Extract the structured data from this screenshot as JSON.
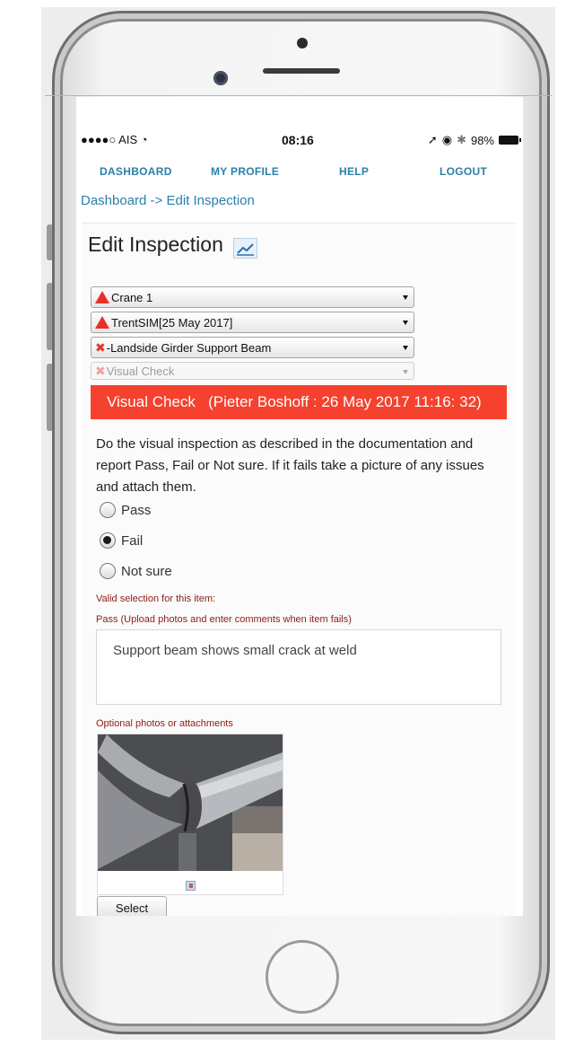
{
  "status_bar": {
    "carrier": "●●●●○ AIS",
    "wifi_icon": "wifi-icon",
    "time": "08:16",
    "battery": "98%"
  },
  "nav": {
    "dashboard": "DASHBOARD",
    "profile": "MY PROFILE",
    "help": "HELP",
    "logout": "LOGOUT"
  },
  "breadcrumb": "Dashboard -> Edit Inspection",
  "page": {
    "title": "Edit Inspection"
  },
  "selects": [
    {
      "icon": "warning-icon",
      "label": "Crane 1"
    },
    {
      "icon": "warning-icon",
      "label": "TrentSIM[25 May 2017]"
    },
    {
      "icon": "x-icon",
      "label": "-Landside Girder Support Beam"
    },
    {
      "icon": "x-icon",
      "label": "Visual Check"
    }
  ],
  "banner": "Visual Check   (Pieter Boshoff : 26 May 2017 11:16: 32)",
  "instructions": "Do the visual inspection as described in the documentation and report Pass, Fail or Not sure. If it fails take a picture of any issues and attach them.",
  "radios": [
    {
      "label": "Pass",
      "checked": false
    },
    {
      "label": "Fail",
      "checked": true
    },
    {
      "label": "Not sure",
      "checked": false
    }
  ],
  "valid_label": "Valid selection for this item:",
  "valid_value": "Pass (Upload photos and enter comments when item fails)",
  "comment": "Support beam shows small crack at weld",
  "attachments_label": "Optional photos or attachments",
  "select_button": "Select",
  "colors": {
    "banner": "#f5412d",
    "link": "#2a7fa8",
    "error": "#e8302a",
    "small_label": "#8b1d14"
  }
}
